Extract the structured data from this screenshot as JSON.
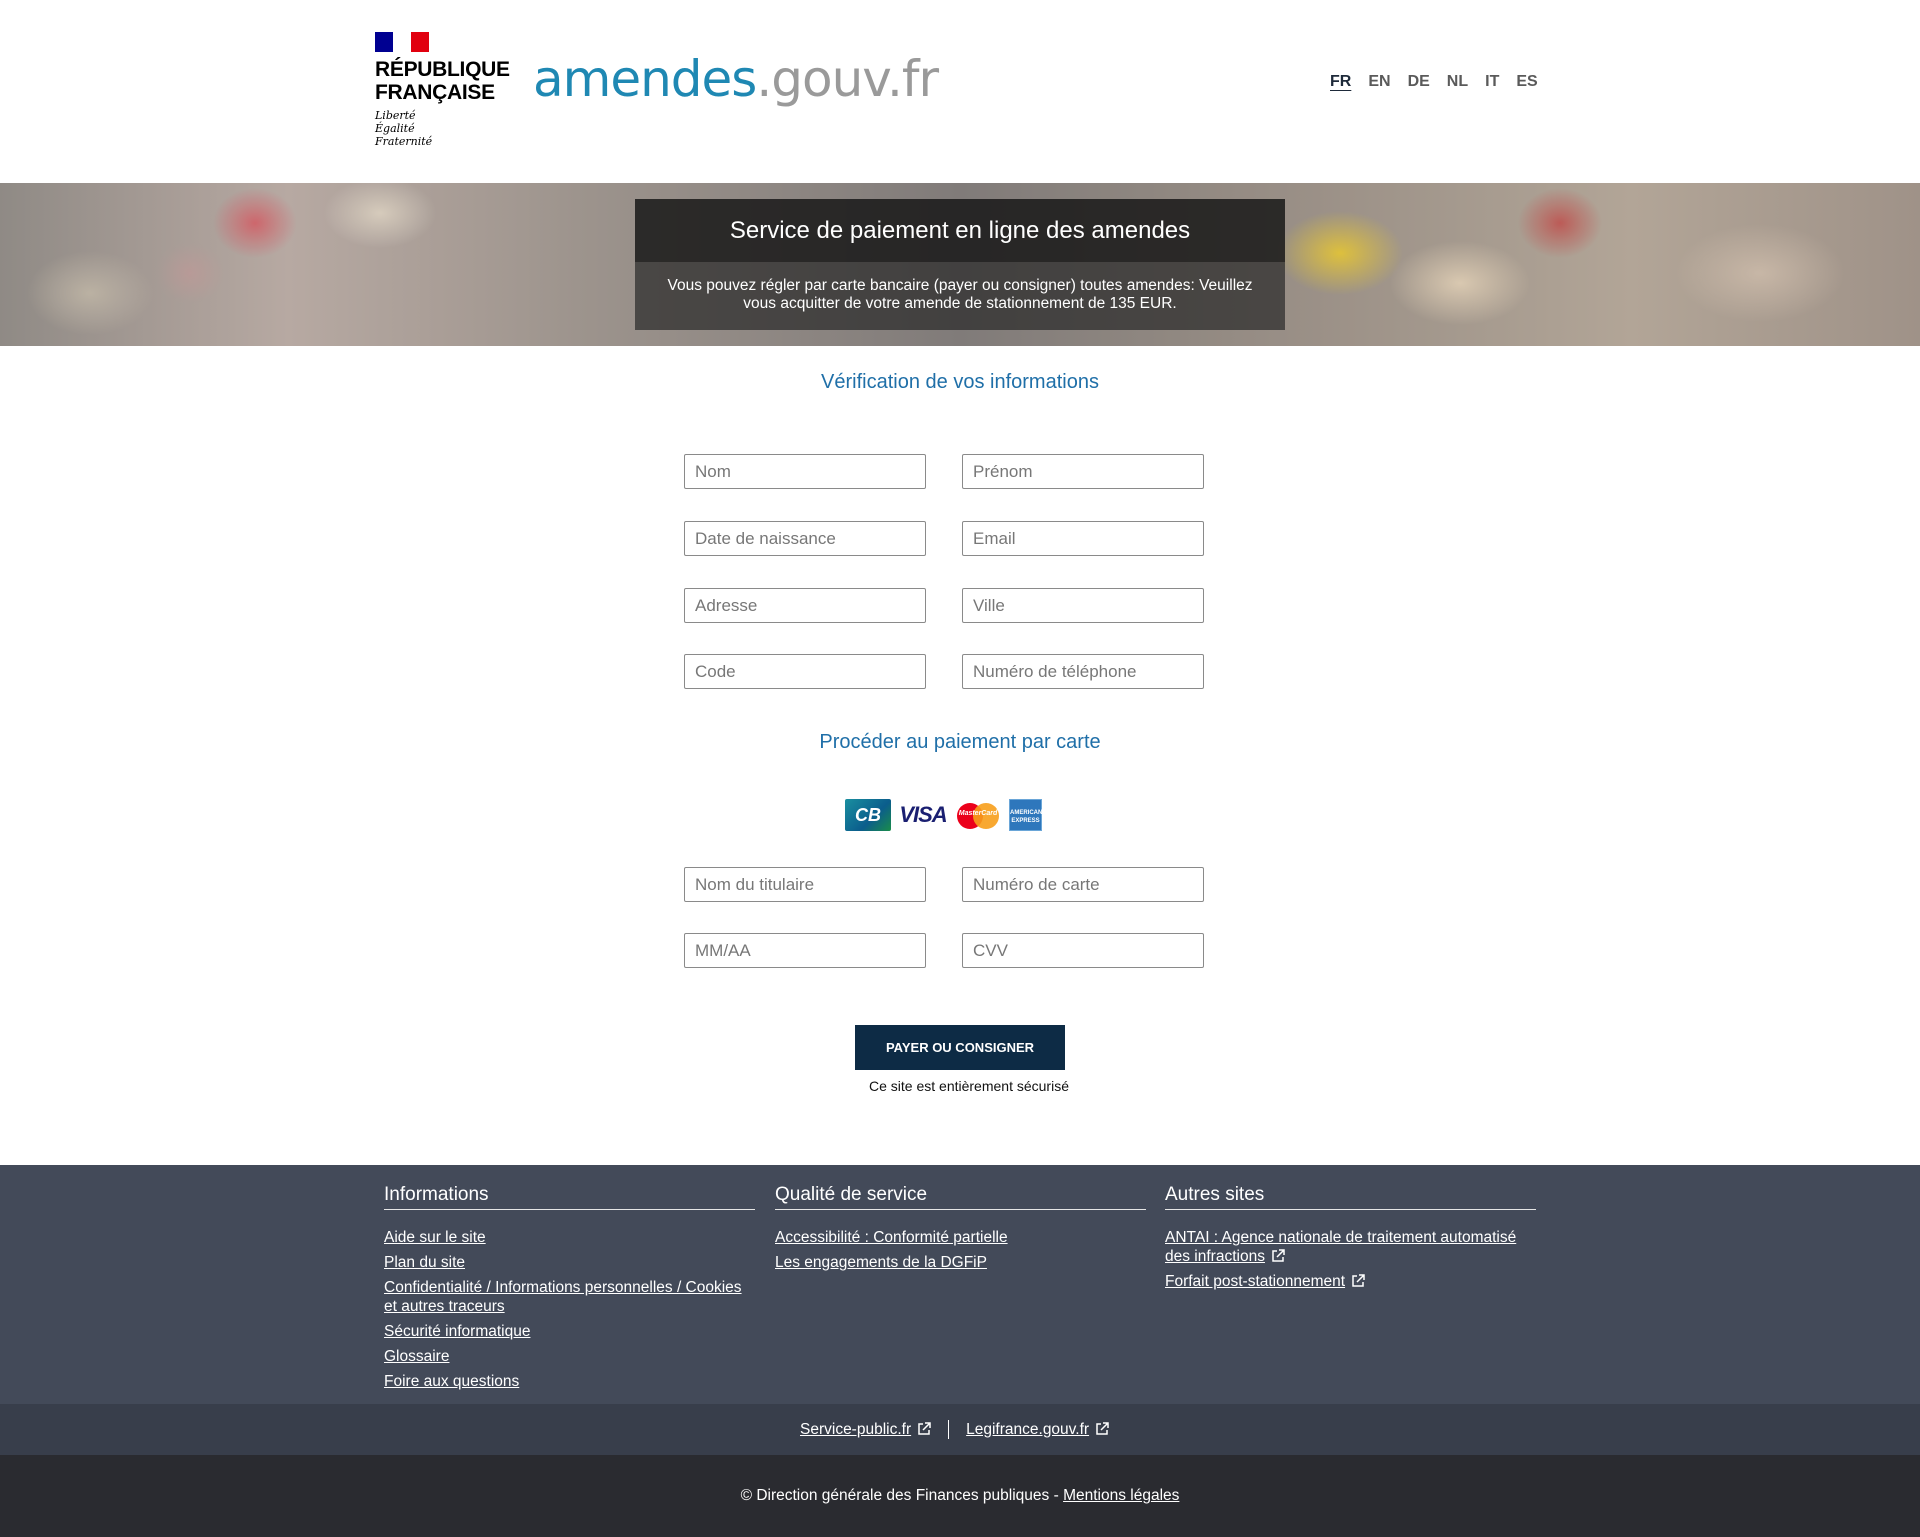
{
  "header": {
    "rf_name_line1": "RÉPUBLIQUE",
    "rf_name_line2": "FRANÇAISE",
    "rf_motto_1": "Liberté",
    "rf_motto_2": "Égalité",
    "rf_motto_3": "Fraternité",
    "site_name_part1": "amendes",
    "site_name_part2": ".gouv.fr",
    "languages": [
      "FR",
      "EN",
      "DE",
      "NL",
      "IT",
      "ES"
    ],
    "active_language": "FR"
  },
  "banner": {
    "title": "Service de paiement en ligne des amendes",
    "text": "Vous pouvez régler par carte bancaire (payer ou consigner) toutes amendes: Veuillez vous acquitter de votre amende de stationnement de 135 EUR."
  },
  "form": {
    "verification_title": "Vérification de vos informations",
    "nom_placeholder": "Nom",
    "prenom_placeholder": "Prénom",
    "naissance_placeholder": "Date de naissance",
    "email_placeholder": "Email",
    "adresse_placeholder": "Adresse",
    "ville_placeholder": "Ville",
    "code_placeholder": "Code",
    "telephone_placeholder": "Numéro de téléphone",
    "payment_title": "Procéder au paiement par carte",
    "card_logos": [
      "CB",
      "VISA",
      "MasterCard",
      "AMERICAN EXPRESS"
    ],
    "titulaire_placeholder": "Nom du titulaire",
    "numero_carte_placeholder": "Numéro de carte",
    "expiry_placeholder": "MM/AA",
    "cvv_placeholder": "CVV",
    "submit_label": "PAYER OU CONSIGNER",
    "secure_text": "Ce site est entièrement sécurisé"
  },
  "footer": {
    "informations": {
      "title": "Informations",
      "links": [
        "Aide sur le site",
        "Plan du site",
        "Confidentialité / Informations personnelles / Cookies et autres traceurs",
        "Sécurité informatique",
        "Glossaire",
        "Foire aux questions"
      ]
    },
    "qualite": {
      "title": "Qualité de service",
      "links": [
        "Accessibilité : Conformité partielle",
        "Les engagements de la DGFiP"
      ]
    },
    "autres": {
      "title": "Autres sites",
      "links": [
        "ANTAI : Agence nationale de traitement automatisé des infractions",
        "Forfait post-stationnement"
      ]
    },
    "bottom_links": [
      "Service-public.fr",
      "Legifrance.gouv.fr"
    ],
    "copyright": "© Direction générale des Finances publiques - ",
    "legal_link": "Mentions légales"
  }
}
